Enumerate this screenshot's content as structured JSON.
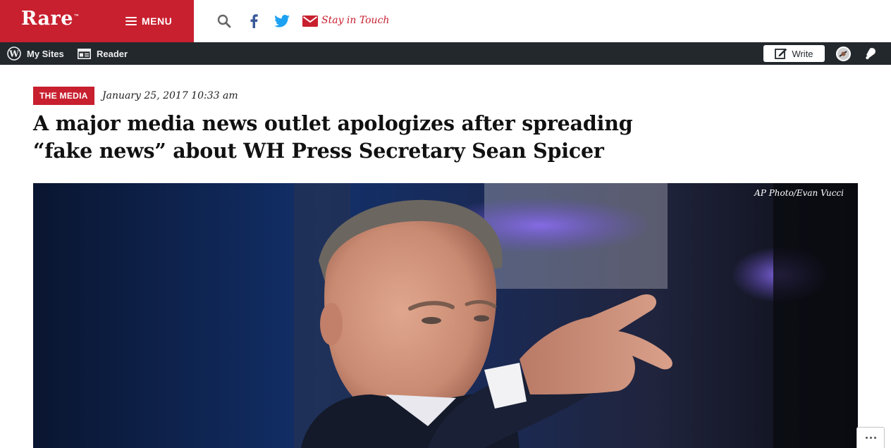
{
  "site_header": {
    "logo": "Rare",
    "logo_mark": "™",
    "menu_label": "MENU",
    "icons": [
      "hamburger-icon",
      "search-icon",
      "facebook-icon",
      "twitter-icon",
      "mail-icon"
    ],
    "stay_in_touch": "Stay in Touch"
  },
  "admin_bar": {
    "my_sites": "My Sites",
    "reader": "Reader",
    "write": "Write",
    "icons": [
      "wordpress-icon",
      "reader-icon",
      "write-icon",
      "avatar",
      "notifications-icon"
    ]
  },
  "article": {
    "category": "THE MEDIA",
    "date": "January 25, 2017 10:33 am",
    "headline": "A major media news outlet apologizes after spreading “fake news” about WH Press Secretary Sean Spicer",
    "photo_credit": "AP Photo/Evan Vucci"
  },
  "colors": {
    "brand_red": "#c8202f",
    "admin_bar_bg": "#23282d",
    "facebook": "#3b5998",
    "twitter": "#1da1f2"
  }
}
